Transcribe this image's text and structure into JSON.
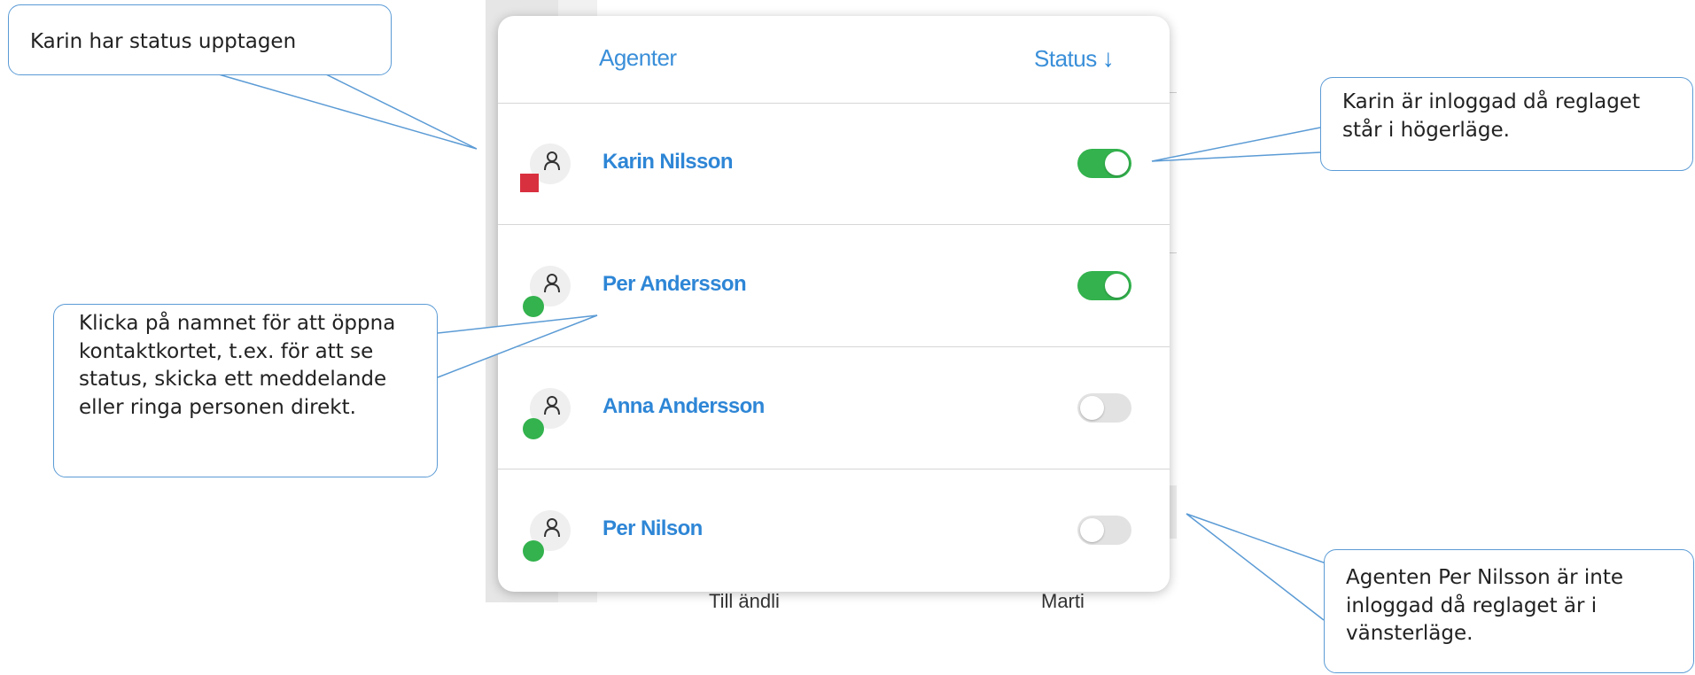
{
  "header": {
    "agents_label": "Agenter",
    "status_label": "Status",
    "sort_icon": "arrow-down-icon"
  },
  "agents": [
    {
      "name": "Karin Nilsson",
      "presence": "busy",
      "presence_color": "#d9303f",
      "logged_in": true
    },
    {
      "name": "Per Andersson",
      "presence": "available",
      "presence_color": "#33b24d",
      "logged_in": true
    },
    {
      "name": "Anna Andersson",
      "presence": "available",
      "presence_color": "#33b24d",
      "logged_in": false
    },
    {
      "name": "Per Nilson",
      "presence": "available",
      "presence_color": "#33b24d",
      "logged_in": false
    }
  ],
  "background": {
    "row_left_text": "Till ändli",
    "row_right_text": "Marti"
  },
  "callouts": {
    "busy_status": "Karin har status upptagen",
    "logged_in": "Karin är inloggad då reglaget står i högerläge.",
    "click_name": "Klicka på namnet för att öppna kontaktkortet, t.ex. för att se status, skicka ett meddelande eller ringa personen direkt.",
    "logged_out": "Agenten Per Nilsson är inte inloggad då reglaget är i vänsterläge."
  },
  "colors": {
    "accent": "#2e86d6",
    "toggle_on": "#33b24d",
    "toggle_off": "#e2e2e2",
    "callout_border": "#5b9bd5"
  }
}
